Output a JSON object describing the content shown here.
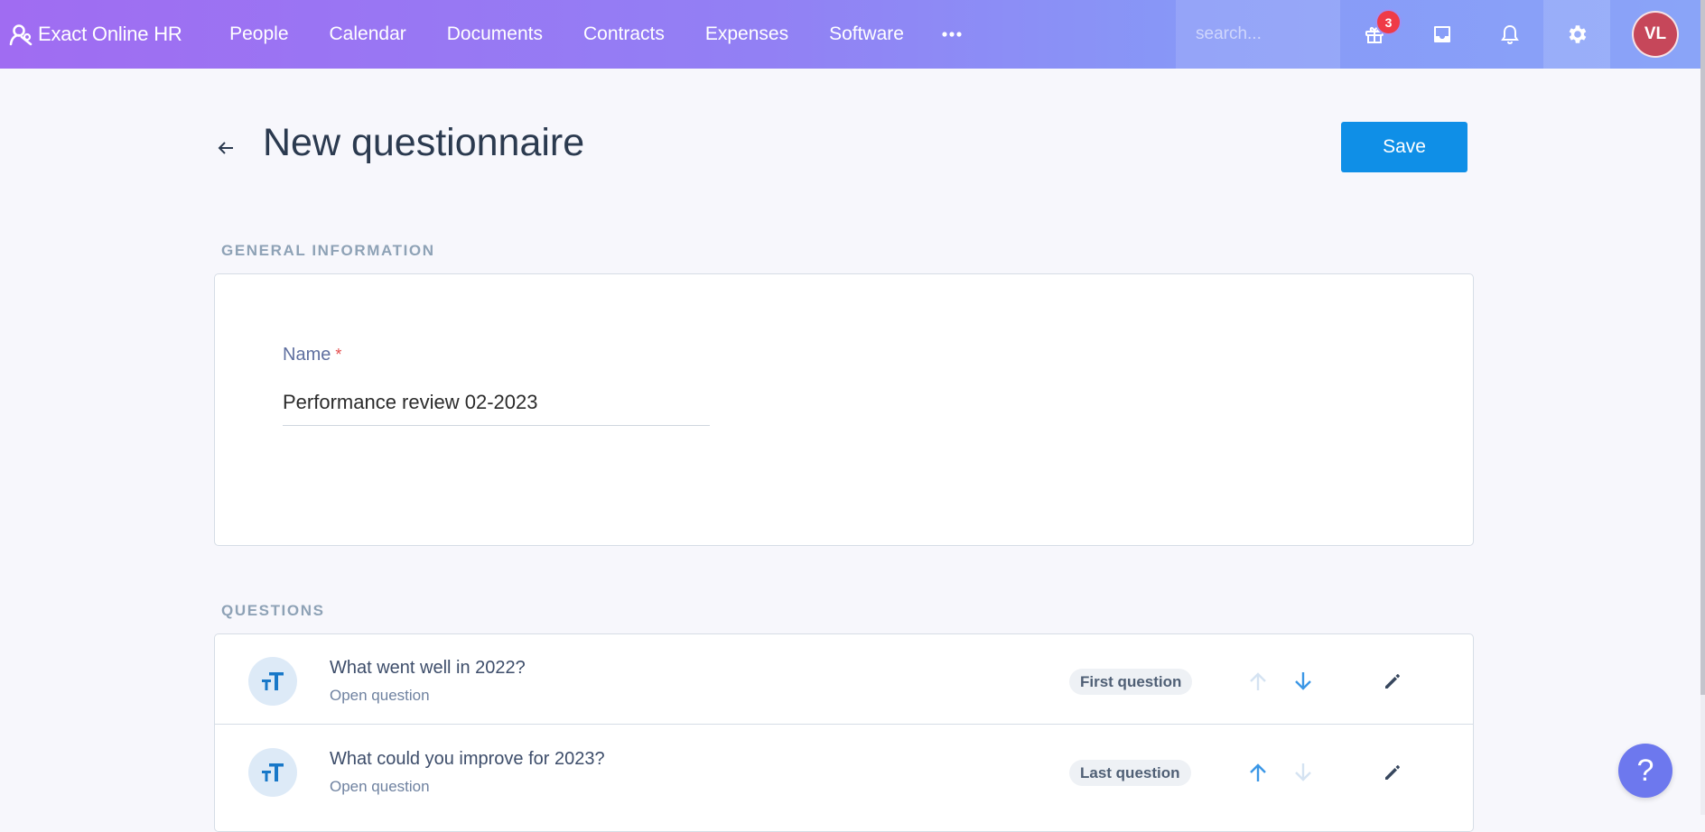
{
  "app": {
    "brand": "Exact Online HR",
    "nav": [
      "People",
      "Calendar",
      "Documents",
      "Contracts",
      "Expenses",
      "Software"
    ],
    "search_placeholder": "search...",
    "gift_badge_count": "3",
    "avatar_initials": "VL",
    "colors": {
      "avatar": "#c6475a",
      "badge": "#ef3b47",
      "primary": "#0f8fe7"
    }
  },
  "page": {
    "title": "New questionnaire",
    "save_label": "Save"
  },
  "general": {
    "section_label": "GENERAL INFORMATION",
    "name_label": "Name",
    "required_marker": "*",
    "name_value": "Performance review 02-2023"
  },
  "questions": {
    "section_label": "QUESTIONS",
    "items": [
      {
        "title": "What went well in 2022?",
        "type": "Open question",
        "position_label": "First question",
        "icon": "text-size-icon"
      },
      {
        "title": "What could you improve for 2023?",
        "type": "Open question",
        "position_label": "Last question",
        "icon": "text-size-icon"
      }
    ]
  },
  "help": {
    "label": "?"
  }
}
